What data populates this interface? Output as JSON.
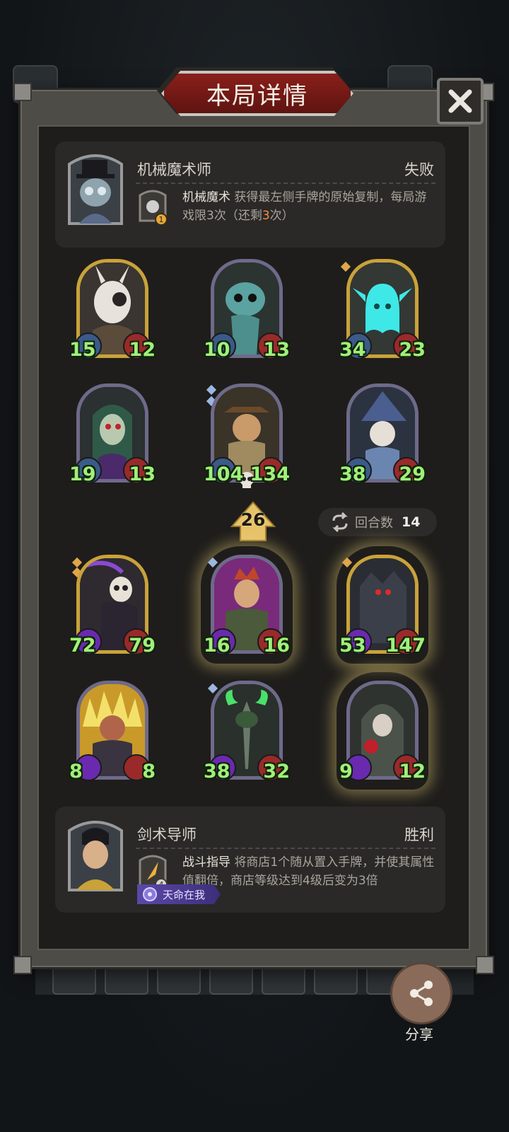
{
  "title": "本局详情",
  "close_icon": "close-icon",
  "top_hero": {
    "name": "机械魔术师",
    "result": "失败",
    "skill_name": "机械魔术",
    "skill_desc_pre": " 获得最左侧手牌的原始复制，每局游戏限3次（还剩",
    "skill_remaining": "3",
    "skill_desc_post": "次）",
    "skill_badge": "1"
  },
  "units_top": [
    {
      "atk": "15",
      "hp": "12"
    },
    {
      "atk": "10",
      "hp": "13"
    },
    {
      "atk": "34",
      "hp": "23"
    },
    {
      "atk": "19",
      "hp": "13"
    },
    {
      "atk": "104",
      "hp": "134"
    },
    {
      "atk": "38",
      "hp": "29"
    }
  ],
  "shop_level": "26",
  "round_label": "回合数",
  "round_value": "14",
  "units_bottom": [
    {
      "atk": "72",
      "hp": "79"
    },
    {
      "atk": "16",
      "hp": "16"
    },
    {
      "atk": "53",
      "hp": "147"
    },
    {
      "atk": "8",
      "hp": "8"
    },
    {
      "atk": "38",
      "hp": "32"
    },
    {
      "atk": "9",
      "hp": "12"
    }
  ],
  "bottom_hero": {
    "name": "剑术导师",
    "result": "胜利",
    "skill_name": "战斗指导",
    "skill_desc": " 将商店1个随从置入手牌，并使其属性值翻倍，商店等级达到4级后变为3倍",
    "skill_badge": "4",
    "destiny_tag": "天命在我"
  },
  "share_label": "分享",
  "colors": {
    "panel": "#4e4c47",
    "panel_inner": "#1e1d1b",
    "title_banner": "#7a1c17",
    "stat_green": "#9ff07a",
    "highlight_orange": "#ff8a3a",
    "gold_frame": "#c9a23a",
    "purple_frame": "#6e6a8a"
  }
}
